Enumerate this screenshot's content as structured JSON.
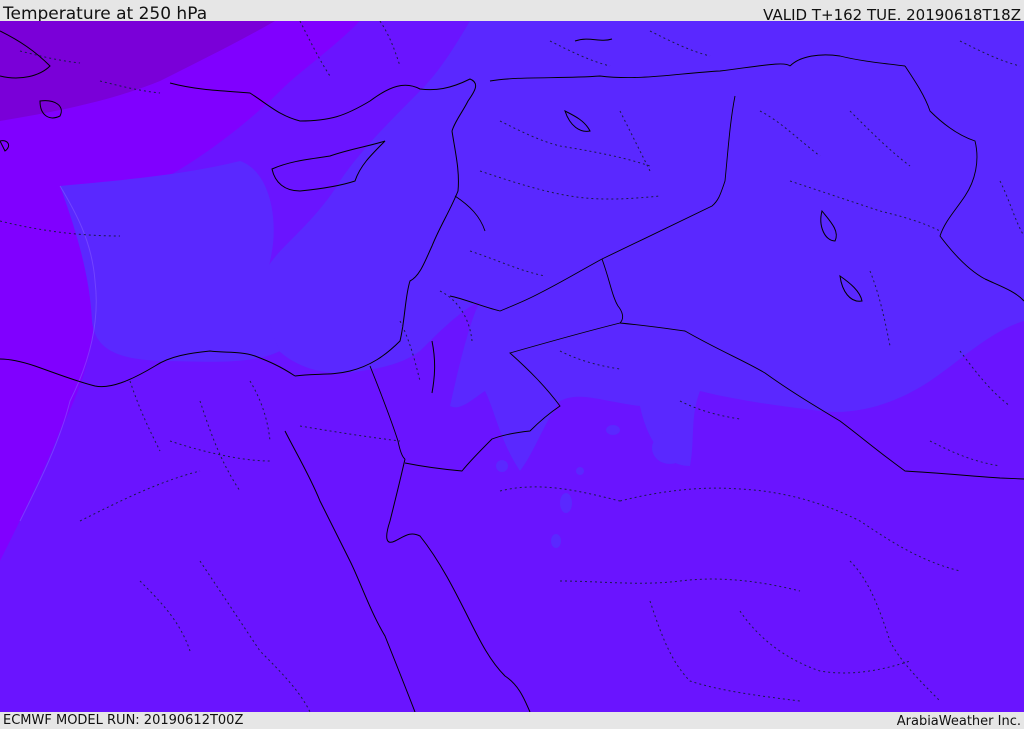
{
  "header": {
    "title": "Temperature at 250 hPa",
    "valid_time": "VALID T+162 TUE. 20190618T18Z"
  },
  "footer": {
    "model_run": "ECMWF MODEL RUN: 20190612T00Z",
    "credit": "ArabiaWeather Inc."
  },
  "map": {
    "colors": {
      "coldest_band": "#7a00d8",
      "cold_band": "#8000ff",
      "mid_band": "#6a14ff",
      "warm_band": "#5a28ff",
      "coastline": "#000000",
      "border_line": "#1a1a4a"
    }
  }
}
